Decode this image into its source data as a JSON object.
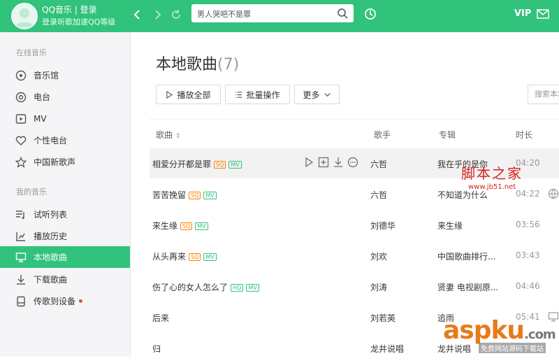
{
  "colors": {
    "brand": "#31c27c",
    "sq_tag": "#ff7f00",
    "mv_tag": "#31c27c",
    "red_dot": "#e74c3c"
  },
  "header": {
    "user_title": "QQ音乐 | 登录",
    "user_subtitle": "登录听歌加速QQ等级",
    "search_value": "男人哭吧不是罪",
    "vip_label": "VIP"
  },
  "sidebar": {
    "online_title": "在线音乐",
    "online_items": [
      {
        "label": "音乐馆",
        "icon": "music-hall-icon"
      },
      {
        "label": "电台",
        "icon": "radio-icon"
      },
      {
        "label": "MV",
        "icon": "mv-icon"
      },
      {
        "label": "个性电台",
        "icon": "heart-icon"
      },
      {
        "label": "中国新歌声",
        "icon": "star-icon"
      }
    ],
    "my_title": "我的音乐",
    "my_items": [
      {
        "label": "试听列表",
        "icon": "playlist-icon"
      },
      {
        "label": "播放历史",
        "icon": "history-icon"
      },
      {
        "label": "本地歌曲",
        "icon": "monitor-icon",
        "active": true
      },
      {
        "label": "下载歌曲",
        "icon": "download-icon"
      },
      {
        "label": "传歌到设备",
        "icon": "device-icon",
        "badge": "red-dot"
      }
    ]
  },
  "main": {
    "title": "本地歌曲",
    "count": "(7)",
    "play_all": "播放全部",
    "batch": "批量操作",
    "more": "更多",
    "search_local": "搜索本地歌曲",
    "columns": {
      "song": "歌曲",
      "singer": "歌手",
      "album": "专辑",
      "duration": "时长"
    },
    "songs": [
      {
        "title": "相爱分开都是罪",
        "tags": [
          "SQ",
          "MV"
        ],
        "singer": "六哲",
        "album": "我在乎的是你",
        "duration": "04:20"
      },
      {
        "title": "苦苦挽留",
        "tags": [
          "SQ",
          "MV"
        ],
        "singer": "六哲",
        "album": "不知道为什么",
        "duration": "04:22"
      },
      {
        "title": "来生缘",
        "tags": [
          "SQ",
          "MV"
        ],
        "singer": "刘德华",
        "album": "来生缘",
        "duration": "03:56"
      },
      {
        "title": "从头再来",
        "tags": [
          "SQ",
          "MV"
        ],
        "singer": "刘欢",
        "album": "中国歌曲排行...",
        "duration": "03:43"
      },
      {
        "title": "伤了心的女人怎么了",
        "tags": [
          "HQ",
          "MV"
        ],
        "singer": "刘涛",
        "album": "贤妻 电视剧原...",
        "duration": "04:46"
      },
      {
        "title": "后来",
        "tags": [],
        "singer": "刘若英",
        "album": "追雨",
        "duration": "05:41"
      },
      {
        "title": "归",
        "tags": [],
        "singer": "龙井说唱",
        "album": "龙井说唱",
        "duration": ""
      }
    ]
  },
  "watermarks": {
    "jb51_cn": "脚本之家",
    "jb51_url": "www.jb51.net",
    "aspku": "aspku",
    "aspku_suffix": ".com",
    "aspku_sub": "免费网站源码下载站"
  }
}
